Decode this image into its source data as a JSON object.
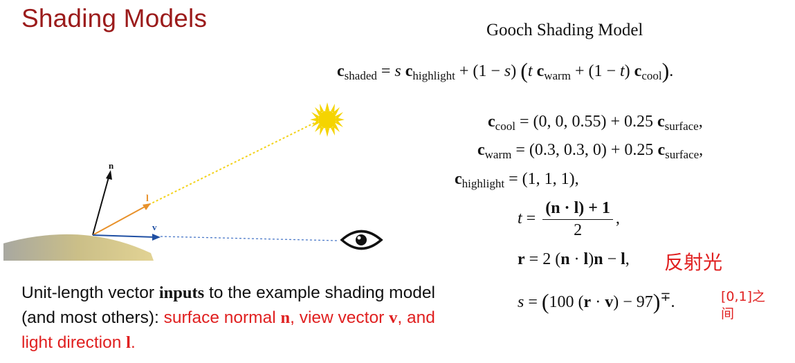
{
  "slide": {
    "title": "Shading Models",
    "gooch_title": "Gooch Shading Model"
  },
  "figure": {
    "label_n": "n",
    "label_l": "l",
    "label_v": "v"
  },
  "caption": {
    "part1": "Unit-length vector ",
    "bold_inputs": "inputs",
    "part2": " to the example shading model (and most others): ",
    "red1": "surface normal ",
    "n": "n",
    "red2": ", view vector ",
    "v": "v",
    "red3": ", and light direction ",
    "l": "l",
    "red4": "."
  },
  "equations": {
    "shaded": {
      "c": "c",
      "sub_shaded": "shaded",
      "eq": " = ",
      "s": "s",
      "c2": "c",
      "sub_highlight": "highlight",
      "plus": " + (1 − ",
      "s2": "s",
      "close": ") ",
      "lparen": "(",
      "t": "t",
      "c3": "c",
      "sub_warm": "warm",
      "plus2": " + (1 − ",
      "t2": "t",
      "close2": ") ",
      "c4": "c",
      "sub_cool": "cool",
      "rparen": ")",
      "dot": "."
    },
    "cool": {
      "c": "c",
      "sub": "cool",
      "rhs": " = (0, 0, 0.55) + 0.25 ",
      "c2": "c",
      "sub2": "surface",
      "end": ","
    },
    "warm": {
      "c": "c",
      "sub": "warm",
      "rhs": " = (0.3, 0.3, 0) + 0.25 ",
      "c2": "c",
      "sub2": "surface",
      "end": ","
    },
    "highlight": {
      "c": "c",
      "sub": "highlight",
      "rhs": " = (1, 1, 1),"
    },
    "t_eq": {
      "t": "t",
      "eq": " = ",
      "num": "(n · l) + 1",
      "den": "2",
      "end": ","
    },
    "r_eq": {
      "r": "r",
      "rhs": " = 2 (",
      "n": "n",
      "dot": " · ",
      "l": "l",
      "mid": ")",
      "n2": "n",
      "minus": " − ",
      "l2": "l",
      "end": ","
    },
    "s_eq": {
      "s": "s",
      "eq": " = ",
      "lparen": "(",
      "body": "100 (",
      "r": "r",
      "dot": " · ",
      "v": "v",
      "end_body": ") − 97",
      "rparen": ")",
      "sup": "∓",
      "end": "."
    }
  },
  "annotations": {
    "reflect_note": "反射光",
    "range_note_line1": "[0,1]之",
    "range_note_line2": "间"
  },
  "colors": {
    "title": "#9b1b1b",
    "annotation_red": "#e02020",
    "light_vector": "#e8912a",
    "view_vector": "#1f4fa3",
    "sun": "#f5d400"
  }
}
